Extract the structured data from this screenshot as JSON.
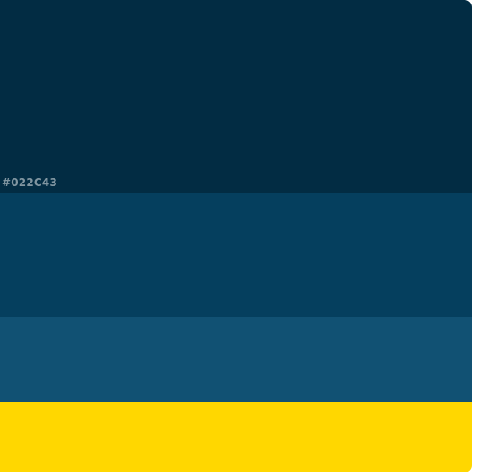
{
  "palette": {
    "swatches": [
      {
        "hex": "#022C43",
        "label": "#022C43"
      },
      {
        "hex": "#053F5E"
      },
      {
        "hex": "#115173"
      },
      {
        "hex": "#FFD700"
      }
    ]
  }
}
